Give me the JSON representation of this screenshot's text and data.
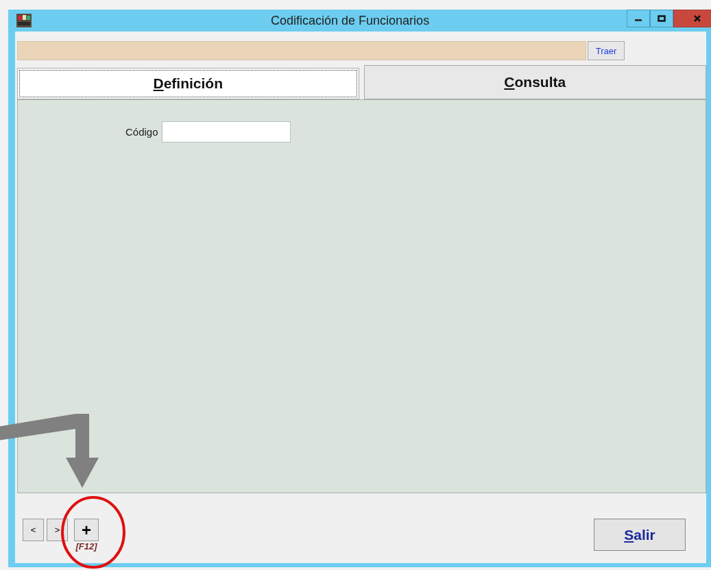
{
  "window": {
    "title": "Codificación de Funcionarios"
  },
  "fetch_button": "Traer",
  "tabs": [
    {
      "label": "Definición",
      "selected": true
    },
    {
      "label": "Consulta",
      "selected": false
    }
  ],
  "form": {
    "fields": [
      {
        "label": "Código"
      }
    ]
  },
  "nav_buttons": [
    {
      "label": "<"
    },
    {
      "label": ">"
    },
    {
      "label": "+",
      "shortcut": "[F12]"
    }
  ],
  "exit_button": "Salir"
}
